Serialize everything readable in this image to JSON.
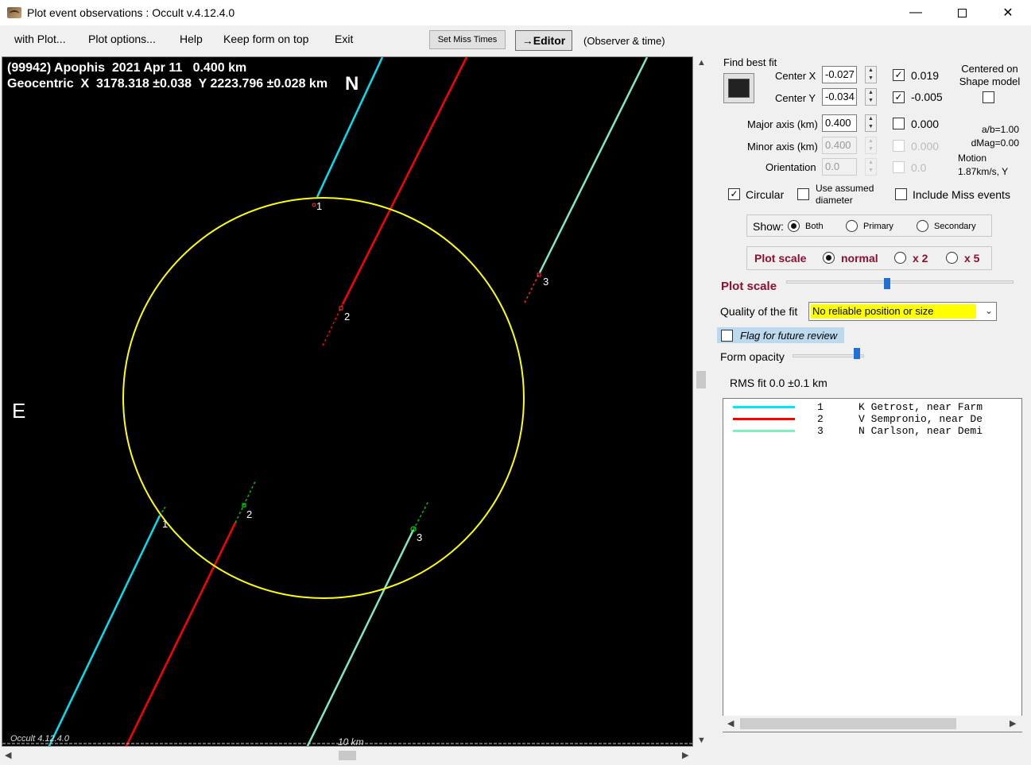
{
  "window": {
    "title": "Plot event observations : Occult v.4.12.4.0",
    "minimize": "—",
    "close": "✕"
  },
  "menu": {
    "items": [
      "with Plot...",
      "Plot options...",
      "Help",
      "Keep form on top",
      "Exit"
    ],
    "set_miss_times": "Set Miss Times",
    "editor": "→Editor",
    "observer_time": "(Observer & time)"
  },
  "plot": {
    "title_line1": "(99942) Apophis  2021 Apr 11   0.400 km",
    "title_line2": "Geocentric  X  3178.318 ±0.038  Y 2223.796 ±0.028 km",
    "north": "N",
    "east": "E",
    "footer": "Occult 4.12.4.0",
    "scale_label": "10 km",
    "ellipse_color": "#ffff00",
    "chords": [
      {
        "id": "1",
        "color": "#00e0f0"
      },
      {
        "id": "2",
        "color": "#ff0000"
      },
      {
        "id": "3",
        "color": "#80e8c8"
      }
    ]
  },
  "fit": {
    "title": "Find best fit",
    "center_x_label": "Center X",
    "center_x": "-0.027",
    "center_x_unc": "0.019",
    "center_x_checked": true,
    "center_y_label": "Center Y",
    "center_y": "-0.034",
    "center_y_unc": "-0.005",
    "center_y_checked": true,
    "centered_shape": "Centered on\nShape model",
    "major_label": "Major axis (km)",
    "major": "0.400",
    "major_unc": "0.000",
    "minor_label": "Minor axis (km)",
    "minor": "0.400",
    "minor_unc": "0.000",
    "orient_label": "Orientation",
    "orient": "0.0",
    "orient_unc": "0.0",
    "ab": "a/b=1.00",
    "dmag": "dMag=0.00",
    "motion_label": "Motion",
    "motion": "1.87km/s, Y",
    "circular": "Circular",
    "circular_checked": true,
    "use_assumed": "Use assumed\ndiameter",
    "include_miss": "Include Miss events",
    "show_label": "Show:",
    "show_both": "Both",
    "show_primary": "Primary",
    "show_secondary": "Secondary",
    "plot_scale_label": "Plot scale",
    "scale_normal": "normal",
    "scale_x2": "x 2",
    "scale_x5": "x 5",
    "plot_scale_slider_label": "Plot scale",
    "quality_label": "Quality of the fit",
    "quality_value": "No reliable position or size",
    "flag_label": "Flag for future review",
    "form_opacity_label": "Form opacity",
    "rms": "RMS fit 0.0 ±0.1 km"
  },
  "observers": [
    {
      "num": "1",
      "name": "K Getrost, near Farm",
      "color": "#00e5ff"
    },
    {
      "num": "2",
      "name": "V Sempronio, near De",
      "color": "#ff0000"
    },
    {
      "num": "3",
      "name": "N Carlson, near Demi",
      "color": "#80f0c0"
    }
  ]
}
